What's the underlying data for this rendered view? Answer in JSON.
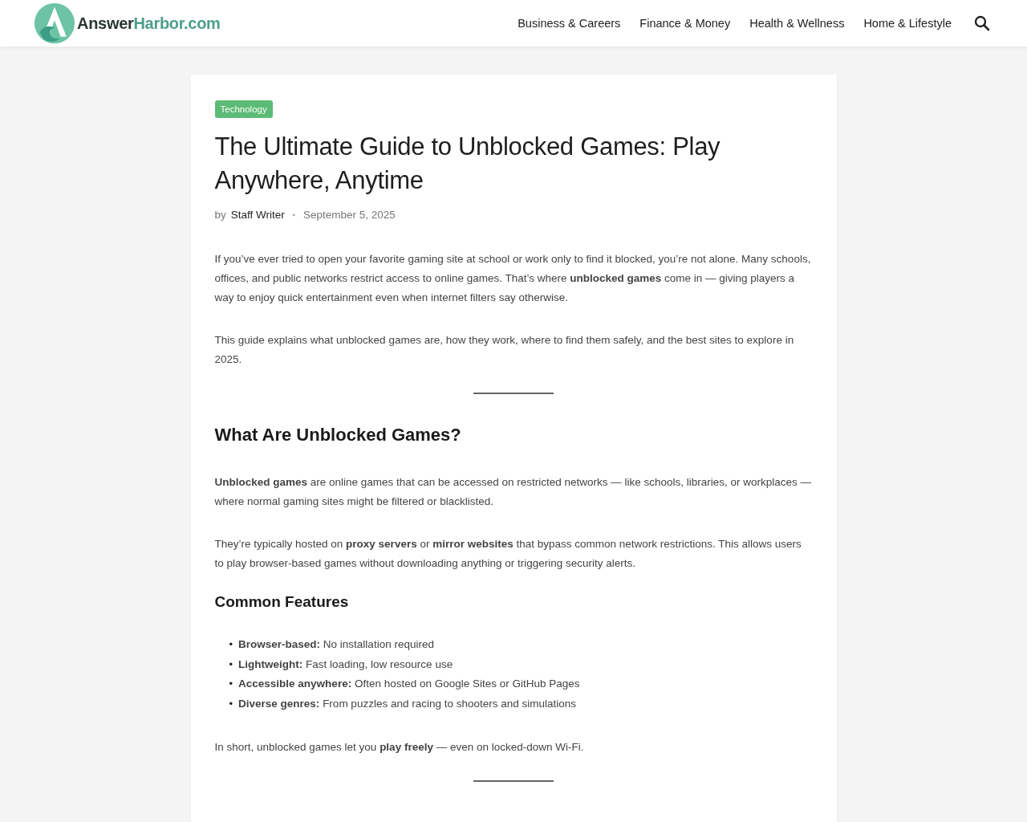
{
  "header": {
    "logo": {
      "name": "Answer",
      "accent": "Harbor.com"
    },
    "nav": [
      {
        "label": "Business & Careers"
      },
      {
        "label": "Finance & Money"
      },
      {
        "label": "Health & Wellness"
      },
      {
        "label": "Home & Lifestyle"
      }
    ]
  },
  "article": {
    "category": "Technology",
    "title": "The Ultimate Guide to Unblocked Games: Play Anywhere, Anytime",
    "byline": {
      "prefix": "by",
      "author": "Staff Writer",
      "separator": "•",
      "date": "September 5, 2025"
    },
    "blocks": [
      {
        "kind": "paragraph",
        "text": "If you’ve ever tried to open your favorite gaming site at school or work only to find it blocked, you’re not alone. Many schools, offices, and public networks restrict access to online games. That’s where **unblocked games** come in — giving players a way to enjoy quick entertainment even when internet filters say otherwise."
      },
      {
        "kind": "paragraph",
        "text": "This guide explains what unblocked games are, how they work, where to find them safely, and the best sites to explore in 2025."
      },
      {
        "kind": "divider"
      },
      {
        "kind": "heading",
        "text": "What Are Unblocked Games?"
      },
      {
        "kind": "paragraph",
        "text": "**Unblocked games** are online games that can be accessed on restricted networks — like schools, libraries, or workplaces — where normal gaming sites might be filtered or blacklisted."
      },
      {
        "kind": "paragraph",
        "text": "They’re typically hosted on **proxy servers** or **mirror websites** that bypass common network restrictions. This allows users to play browser-based games without downloading anything or triggering security alerts."
      },
      {
        "kind": "subheading",
        "text": "Common Features"
      },
      {
        "kind": "list",
        "marker": "•",
        "items": [
          "**Browser-based:** No installation required",
          "**Lightweight:** Fast loading, low resource use",
          "**Accessible anywhere:** Often hosted on Google Sites or GitHub Pages",
          "**Diverse genres:** From puzzles and racing to shooters and simulations"
        ]
      },
      {
        "kind": "paragraph",
        "text": "In short, unblocked games let you **play freely** — even on locked-down Wi-Fi."
      },
      {
        "kind": "divider"
      }
    ]
  }
}
